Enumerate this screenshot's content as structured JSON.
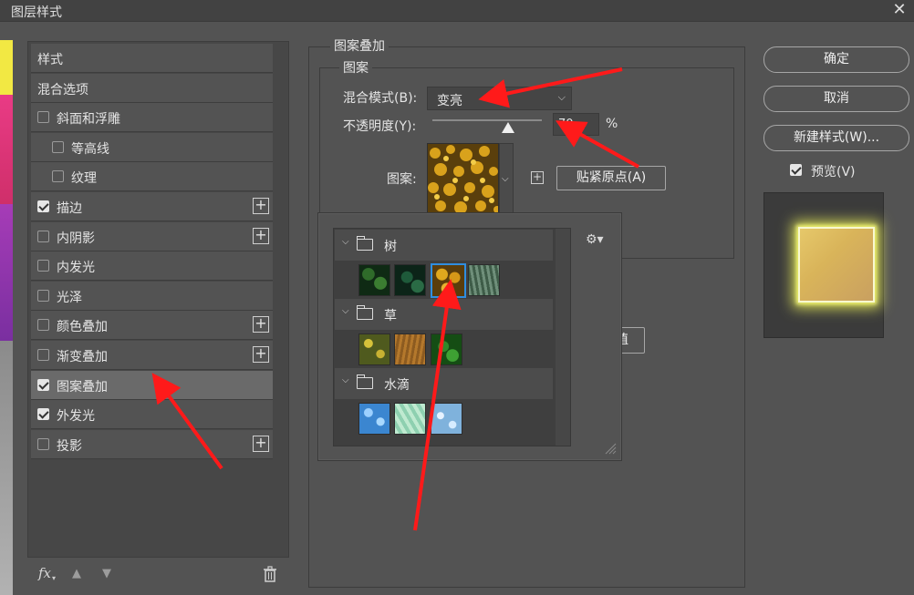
{
  "window": {
    "title": "图层样式"
  },
  "styles_panel": {
    "items": [
      {
        "label": "样式",
        "checkbox": null,
        "plus": false,
        "selected": false
      },
      {
        "label": "混合选项",
        "checkbox": null,
        "plus": false,
        "selected": false
      },
      {
        "label": "斜面和浮雕",
        "checkbox": false,
        "plus": false,
        "selected": false
      },
      {
        "label": "等高线",
        "checkbox": false,
        "plus": false,
        "selected": false,
        "indent": true
      },
      {
        "label": "纹理",
        "checkbox": false,
        "plus": false,
        "selected": false,
        "indent": true
      },
      {
        "label": "描边",
        "checkbox": true,
        "plus": true,
        "selected": false
      },
      {
        "label": "内阴影",
        "checkbox": false,
        "plus": true,
        "selected": false
      },
      {
        "label": "内发光",
        "checkbox": false,
        "plus": false,
        "selected": false
      },
      {
        "label": "光泽",
        "checkbox": false,
        "plus": false,
        "selected": false
      },
      {
        "label": "颜色叠加",
        "checkbox": false,
        "plus": true,
        "selected": false
      },
      {
        "label": "渐变叠加",
        "checkbox": false,
        "plus": true,
        "selected": false
      },
      {
        "label": "图案叠加",
        "checkbox": true,
        "plus": false,
        "selected": true
      },
      {
        "label": "外发光",
        "checkbox": true,
        "plus": false,
        "selected": false
      },
      {
        "label": "投影",
        "checkbox": false,
        "plus": true,
        "selected": false
      }
    ],
    "fx_label": "fx"
  },
  "pattern_overlay": {
    "group_title": "图案叠加",
    "subgroup_title": "图案",
    "blend_mode_label": "混合模式(B):",
    "blend_mode_value": "变亮",
    "opacity_label": "不透明度(Y):",
    "opacity_value": "70",
    "opacity_unit": "%",
    "pattern_label": "图案:",
    "snap_button": "贴紧原点(A)",
    "partial_button": "值"
  },
  "pattern_picker": {
    "groups": [
      {
        "name": "树"
      },
      {
        "name": "草"
      },
      {
        "name": "水滴"
      }
    ]
  },
  "right_column": {
    "ok": "确定",
    "cancel": "取消",
    "new_style": "新建样式(W)...",
    "preview_label": "预览(V)",
    "preview_checked": true
  },
  "colors": {
    "accent_selection": "#2f8ee0",
    "annotation_arrow": "#ff1a1a"
  }
}
